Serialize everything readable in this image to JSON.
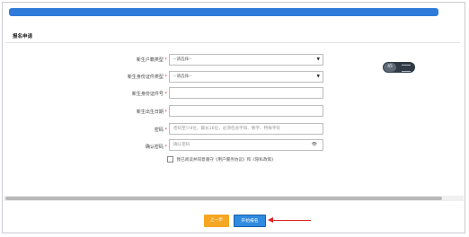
{
  "section": {
    "title": "报名申请"
  },
  "form": {
    "fields": [
      {
        "label": "新生户籍类型",
        "required": true,
        "kind": "select",
        "value": "--请选择--"
      },
      {
        "label": "新生身份证件类型",
        "required": true,
        "kind": "select",
        "value": "--请选择--"
      },
      {
        "label": "新生身份证件号",
        "required": true,
        "kind": "input",
        "value": ""
      },
      {
        "label": "新生出生日期",
        "required": true,
        "kind": "input",
        "value": ""
      },
      {
        "label": "密码",
        "required": true,
        "kind": "input",
        "placeholder": "密码至少8位，最长16位，必须包含字母、数字、特殊字符"
      },
      {
        "label": "确认密码",
        "required": true,
        "kind": "input",
        "placeholder": "确认密码"
      }
    ],
    "agree_text": "我已阅读并同意遵守《用户服务协议》和《隐私政策》"
  },
  "toggle": {
    "label": "45"
  },
  "buttons": {
    "prev": "上一步",
    "start": "开始报名"
  },
  "colors": {
    "accent": "#2e7bd9",
    "prev": "#f5a623",
    "start": "#2f8ae0",
    "annotation": "#e02020"
  }
}
